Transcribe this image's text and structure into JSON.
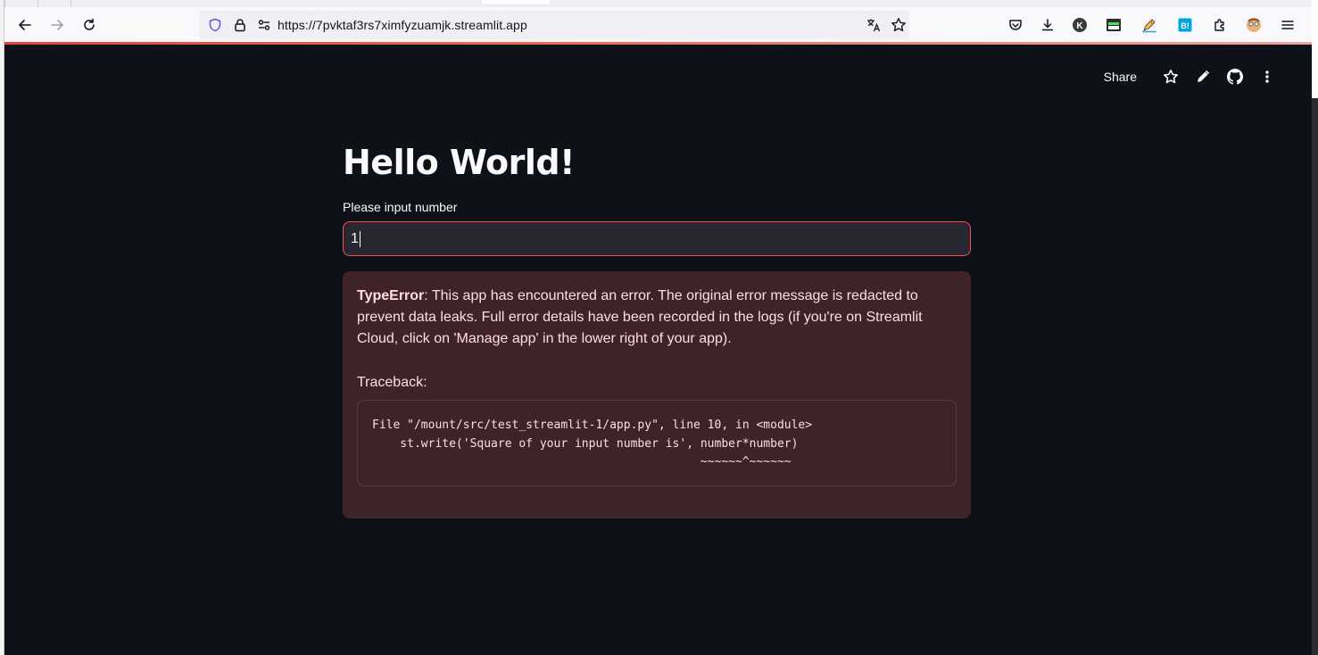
{
  "browser": {
    "url": "https://7pvktaf3rs7ximfyzuamjk.streamlit.app",
    "toolbar_icons": [
      "pocket-icon",
      "download-icon",
      "profile-k-icon",
      "tab-manager-icon",
      "pen-icon",
      "bookmark-b-icon",
      "extensions-icon",
      "avatar-icon",
      "menu-icon"
    ],
    "nav_icons": [
      "back-icon",
      "forward-icon",
      "reload-icon"
    ],
    "url_icons": [
      "shield-icon",
      "lock-icon",
      "permissions-icon",
      "translate-icon",
      "star-icon"
    ],
    "profile_letter": "K",
    "ext_badge": "B!",
    "accent": "#e0443c"
  },
  "app": {
    "toolbar": {
      "share_label": "Share",
      "icons": [
        "star-icon",
        "edit-icon",
        "github-icon",
        "more-icon"
      ]
    },
    "title": "Hello World!",
    "input": {
      "label": "Please input number",
      "value": "1",
      "border_color": "#ff4b4b"
    },
    "error": {
      "type": "TypeError",
      "message": ": This app has encountered an error. The original error message is redacted to prevent data leaks. Full error details have been recorded in the logs (if you're on Streamlit Cloud, click on 'Manage app' in the lower right of your app).",
      "traceback_label": "Traceback:",
      "traceback": "File \"/mount/src/test_streamlit-1/app.py\", line 10, in <module>\n    st.write('Square of your input number is', number*number)\n                                               ~~~~~~^~~~~~~"
    },
    "colors": {
      "background": "#0e1117",
      "error_bg": "#3e2428",
      "error_text": "#ffdede"
    }
  }
}
